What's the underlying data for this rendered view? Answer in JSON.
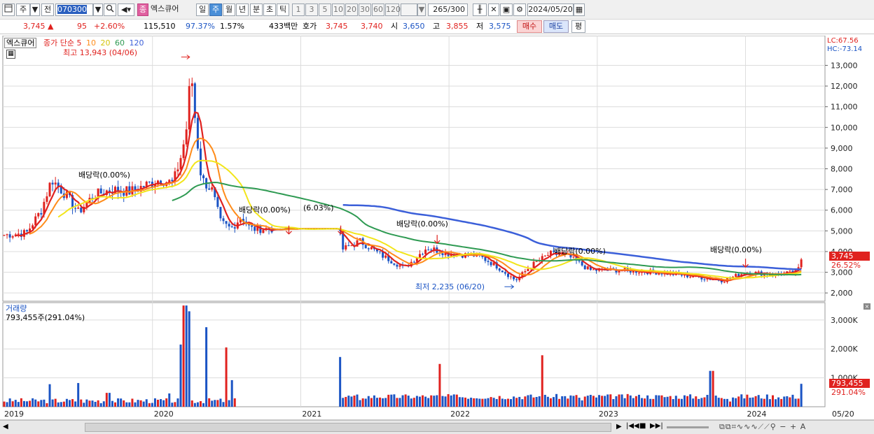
{
  "toolbar": {
    "period_label": "주",
    "prev_label": "전",
    "code": "070300",
    "stock_name": "엑스큐어",
    "stock_badge": "종",
    "intervals": [
      "일",
      "주",
      "월",
      "년",
      "분",
      "초",
      "틱"
    ],
    "active_interval": "주",
    "multipliers": [
      "1",
      "3",
      "5",
      "10",
      "20",
      "30",
      "60",
      "120"
    ],
    "count_value": "265",
    "count_total": "/300",
    "date": "2024/05/20"
  },
  "info": {
    "price": "3,745",
    "change": "95",
    "change_pct": "+2.60%",
    "volume": "115,510",
    "vol_ratio": "97.37%",
    "turnover": "1.57%",
    "amount": "433백만",
    "quote_label": "호가",
    "ask": "3,745",
    "bid": "3,740",
    "open_label": "시",
    "open": "3,650",
    "high_label": "고",
    "high": "3,855",
    "low_label": "저",
    "low": "3,575",
    "buy_label": "매수",
    "sell_label": "매도",
    "avg_label": "평"
  },
  "price_panel": {
    "name_tag": "엑스큐어",
    "ma_title": "종가 단순",
    "ma_periods": [
      "5",
      "10",
      "20",
      "60",
      "120"
    ],
    "ma_colors": [
      "#e0221f",
      "#ff8c1a",
      "#f2e51a",
      "#2e9a52",
      "#3b5fd9"
    ],
    "high_note": "최고 13,943 (04/06)",
    "low_note": "최저 2,235 (06/20)",
    "dividend_notes": [
      "배당락(0.00%)",
      "배당락(0.00%)",
      "(6.03%)",
      "배당락(0.00%)",
      "배당락(0.00%)",
      "배당락(0.00%)"
    ],
    "lc_label": "LC:67.56",
    "hc_label": "HC:-73.14",
    "price_tag": "3,745",
    "pct_tag": "26.52%"
  },
  "volume_panel": {
    "title": "거래량",
    "value_label": "793,455주(291.04%)",
    "tag_value": "793,455",
    "tag_pct": "291.04%"
  },
  "chart_data": [
    {
      "type": "candlestick",
      "title": "엑스큐어",
      "y_ticks": [
        "13,000",
        "12,000",
        "11,000",
        "10,000",
        "9,000",
        "8,000",
        "7,000",
        "6,000",
        "5,000",
        "4,000",
        "3,000",
        "2,000"
      ],
      "ylim": [
        1600,
        14300
      ],
      "x_labels": [
        "2019",
        "2020",
        "2021",
        "2022",
        "2023",
        "2024",
        "05/20"
      ],
      "close_series": [
        {
          "x": 2019.0,
          "y": 4800
        },
        {
          "x": 2019.15,
          "y": 4900
        },
        {
          "x": 2019.25,
          "y": 6000
        },
        {
          "x": 2019.32,
          "y": 7500
        },
        {
          "x": 2019.42,
          "y": 6700
        },
        {
          "x": 2019.5,
          "y": 5900
        },
        {
          "x": 2019.6,
          "y": 6700
        },
        {
          "x": 2019.72,
          "y": 7000
        },
        {
          "x": 2019.85,
          "y": 6900
        },
        {
          "x": 2019.95,
          "y": 7200
        },
        {
          "x": 2020.05,
          "y": 7500
        },
        {
          "x": 2020.14,
          "y": 7300
        },
        {
          "x": 2020.2,
          "y": 8800
        },
        {
          "x": 2020.23,
          "y": 10000
        },
        {
          "x": 2020.26,
          "y": 12800
        },
        {
          "x": 2020.29,
          "y": 10200
        },
        {
          "x": 2020.33,
          "y": 7500
        },
        {
          "x": 2020.4,
          "y": 7000
        },
        {
          "x": 2020.46,
          "y": 5400
        },
        {
          "x": 2020.53,
          "y": 5100
        },
        {
          "x": 2020.6,
          "y": 5700
        },
        {
          "x": 2020.66,
          "y": 5100
        },
        {
          "x": 2020.8,
          "y": 5100
        },
        {
          "x": 2021.26,
          "y": 5100
        },
        {
          "x": 2021.28,
          "y": 4100
        },
        {
          "x": 2021.4,
          "y": 4500
        },
        {
          "x": 2021.55,
          "y": 3800
        },
        {
          "x": 2021.7,
          "y": 3200
        },
        {
          "x": 2021.85,
          "y": 4200
        },
        {
          "x": 2022.0,
          "y": 3900
        },
        {
          "x": 2022.2,
          "y": 3800
        },
        {
          "x": 2022.32,
          "y": 3300
        },
        {
          "x": 2022.45,
          "y": 2600
        },
        {
          "x": 2022.55,
          "y": 3300
        },
        {
          "x": 2022.68,
          "y": 3900
        },
        {
          "x": 2022.8,
          "y": 3800
        },
        {
          "x": 2022.95,
          "y": 3100
        },
        {
          "x": 2023.15,
          "y": 3100
        },
        {
          "x": 2023.4,
          "y": 3000
        },
        {
          "x": 2023.65,
          "y": 2800
        },
        {
          "x": 2023.85,
          "y": 2600
        },
        {
          "x": 2024.0,
          "y": 3000
        },
        {
          "x": 2024.2,
          "y": 2900
        },
        {
          "x": 2024.35,
          "y": 3000
        },
        {
          "x": 2024.38,
          "y": 3745
        }
      ]
    },
    {
      "type": "bar",
      "title": "거래량",
      "y_ticks": [
        "3,000K",
        "2,000K",
        "1,000K"
      ],
      "ylim": [
        0,
        3600
      ],
      "values_k": [
        {
          "x": 2019.3,
          "y": 780
        },
        {
          "x": 2019.5,
          "y": 820
        },
        {
          "x": 2019.7,
          "y": 480
        },
        {
          "x": 2020.12,
          "y": 460
        },
        {
          "x": 2020.19,
          "y": 2150
        },
        {
          "x": 2020.22,
          "y": 3500
        },
        {
          "x": 2020.25,
          "y": 3300
        },
        {
          "x": 2020.36,
          "y": 2750
        },
        {
          "x": 2020.5,
          "y": 2050
        },
        {
          "x": 2020.54,
          "y": 920
        },
        {
          "x": 2021.27,
          "y": 1720
        },
        {
          "x": 2021.4,
          "y": 230
        },
        {
          "x": 2021.94,
          "y": 1480
        },
        {
          "x": 2022.05,
          "y": 420
        },
        {
          "x": 2022.63,
          "y": 1780
        },
        {
          "x": 2022.9,
          "y": 220
        },
        {
          "x": 2023.3,
          "y": 300
        },
        {
          "x": 2023.77,
          "y": 1240
        },
        {
          "x": 2023.9,
          "y": 180
        },
        {
          "x": 2024.38,
          "y": 793
        }
      ]
    }
  ]
}
